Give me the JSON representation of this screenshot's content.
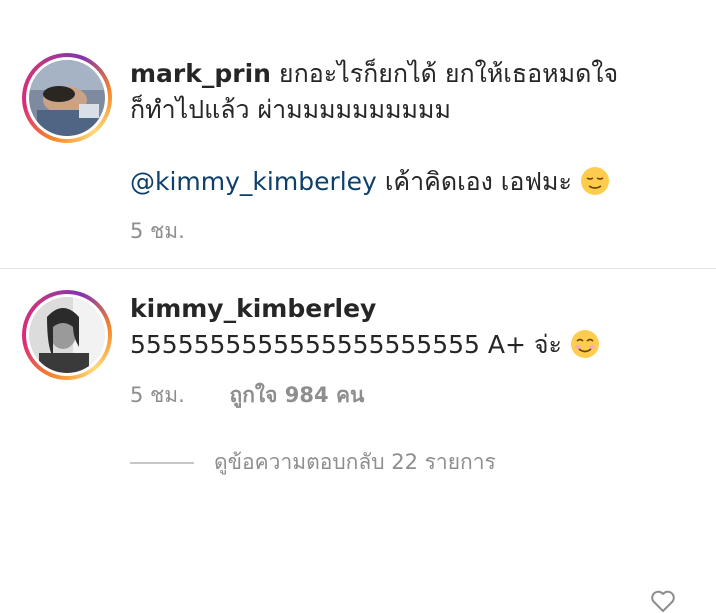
{
  "comments": [
    {
      "username": "mark_prin",
      "text_line1": "ยกอะไรก็ยกได้  ยกให้เธอหมดใจ",
      "text_line2": "ก็ทำไปแล้ว ผ่ามมมมมมมมมม",
      "mention": "@kimmy_kimberley",
      "mention_text": "เค้าคิดเอง เอฟมะ",
      "emoji": "relieved-face",
      "time": "5 ชม."
    },
    {
      "username": "kimmy_kimberley",
      "text": "5555555555555555555555 A+ จ่ะ",
      "emoji": "smiling-face",
      "time": "5 ชม.",
      "likes": "ถูกใจ 984 คน",
      "view_replies": "ดูข้อความตอบกลับ 22 รายการ"
    }
  ],
  "colors": {
    "mention": "#0d3f6b",
    "meta": "#8e8e8e",
    "text": "#262626"
  }
}
